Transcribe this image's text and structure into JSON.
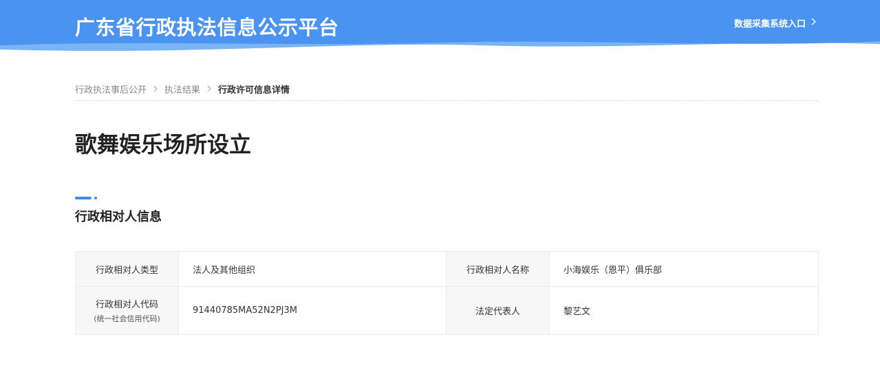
{
  "header": {
    "site_title": "广东省行政执法信息公示平台",
    "entry_link_label": "数据采集系统入口",
    "colors": {
      "banner": "#4a93f0",
      "wave": "#7ab4f5"
    }
  },
  "breadcrumb": {
    "items": [
      "行政执法事后公开",
      "执法结果"
    ],
    "current": "行政许可信息详情"
  },
  "page_title": "歌舞娱乐场所设立",
  "section": {
    "title": "行政相对人信息"
  },
  "info_table": {
    "type_label": "行政相对人类型",
    "type_value": "法人及其他组织",
    "name_label": "行政相对人名称",
    "name_value": "小海娱乐（恩平）俱乐部",
    "code_label": "行政相对人代码",
    "code_sub_label": "(统一社会信用代码)",
    "code_value": "91440785MA52N2PJ3M",
    "rep_label": "法定代表人",
    "rep_value": "黎艺文"
  }
}
